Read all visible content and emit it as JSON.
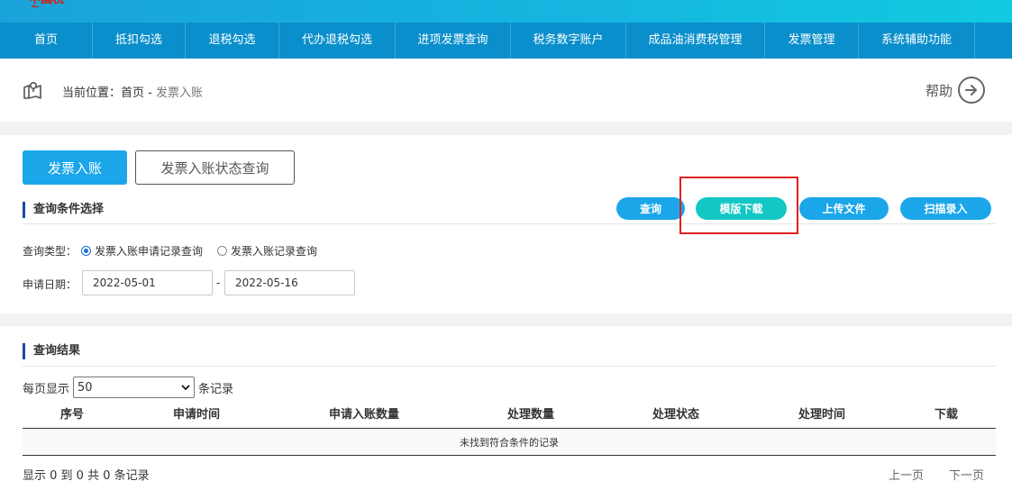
{
  "logo": {
    "text": "中国税务"
  },
  "nav": {
    "items": [
      {
        "label": "首页",
        "w": 103
      },
      {
        "label": "抵扣勾选",
        "w": 103
      },
      {
        "label": "退税勾选",
        "w": 104
      },
      {
        "label": "代办退税勾选",
        "w": 129
      },
      {
        "label": "进项发票查询",
        "w": 128
      },
      {
        "label": "税务数字账户",
        "w": 128
      },
      {
        "label": "成品油消费税管理",
        "w": 154
      },
      {
        "label": "发票管理",
        "w": 104
      },
      {
        "label": "系统辅助功能",
        "w": 129
      }
    ]
  },
  "breadcrumb": {
    "prefix": "当前位置：",
    "home": "首页",
    "sep": " - ",
    "current": "发票入账"
  },
  "help": {
    "label": "帮助"
  },
  "tabs": {
    "primary": "发票入账",
    "secondary": "发票入账状态查询"
  },
  "query": {
    "section_title": "查询条件选择",
    "buttons": {
      "search": "查询",
      "template": "模版下载",
      "upload": "上传文件",
      "scan": "扫描录入"
    },
    "type_label": "查询类型：",
    "type_options": [
      "发票入账申请记录查询",
      "发票入账记录查询"
    ],
    "date_label": "申请日期：",
    "date_from": "2022-05-01",
    "date_sep": "-",
    "date_to": "2022-05-16"
  },
  "results": {
    "section_title": "查询结果",
    "page_size_prefix": "每页显示",
    "page_size": "50",
    "page_size_suffix": "条记录",
    "columns": [
      "序号",
      "申请时间",
      "申请入账数量",
      "处理数量",
      "处理状态",
      "处理时间",
      "下载"
    ],
    "empty_text": "未找到符合条件的记录",
    "summary": "显示 0 到 0 共 0 条记录",
    "prev": "上一页",
    "next": "下一页"
  },
  "colors": {
    "primary": "#1ba6ea",
    "teal": "#12c7c4",
    "nav": "#0a8fcc",
    "highlight": "#e02020"
  }
}
